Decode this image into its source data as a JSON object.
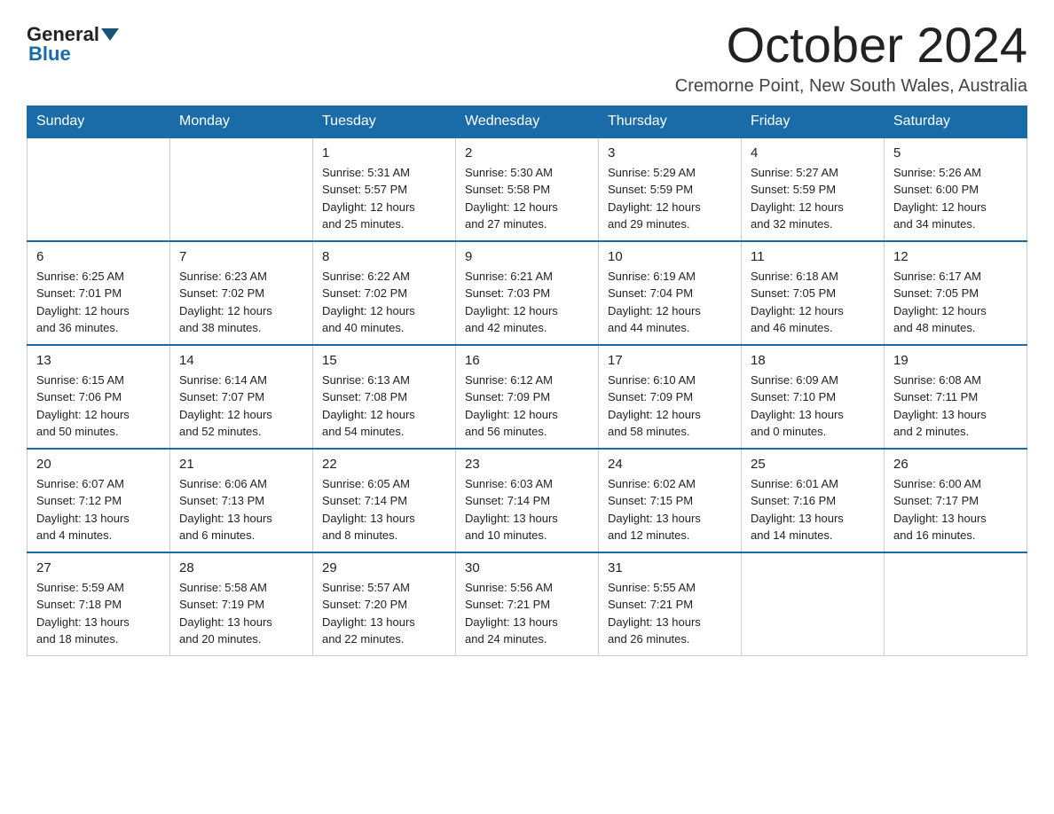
{
  "logo": {
    "general": "General",
    "blue": "Blue"
  },
  "title": "October 2024",
  "location": "Cremorne Point, New South Wales, Australia",
  "days_of_week": [
    "Sunday",
    "Monday",
    "Tuesday",
    "Wednesday",
    "Thursday",
    "Friday",
    "Saturday"
  ],
  "weeks": [
    [
      {
        "day": "",
        "info": ""
      },
      {
        "day": "",
        "info": ""
      },
      {
        "day": "1",
        "info": "Sunrise: 5:31 AM\nSunset: 5:57 PM\nDaylight: 12 hours\nand 25 minutes."
      },
      {
        "day": "2",
        "info": "Sunrise: 5:30 AM\nSunset: 5:58 PM\nDaylight: 12 hours\nand 27 minutes."
      },
      {
        "day": "3",
        "info": "Sunrise: 5:29 AM\nSunset: 5:59 PM\nDaylight: 12 hours\nand 29 minutes."
      },
      {
        "day": "4",
        "info": "Sunrise: 5:27 AM\nSunset: 5:59 PM\nDaylight: 12 hours\nand 32 minutes."
      },
      {
        "day": "5",
        "info": "Sunrise: 5:26 AM\nSunset: 6:00 PM\nDaylight: 12 hours\nand 34 minutes."
      }
    ],
    [
      {
        "day": "6",
        "info": "Sunrise: 6:25 AM\nSunset: 7:01 PM\nDaylight: 12 hours\nand 36 minutes."
      },
      {
        "day": "7",
        "info": "Sunrise: 6:23 AM\nSunset: 7:02 PM\nDaylight: 12 hours\nand 38 minutes."
      },
      {
        "day": "8",
        "info": "Sunrise: 6:22 AM\nSunset: 7:02 PM\nDaylight: 12 hours\nand 40 minutes."
      },
      {
        "day": "9",
        "info": "Sunrise: 6:21 AM\nSunset: 7:03 PM\nDaylight: 12 hours\nand 42 minutes."
      },
      {
        "day": "10",
        "info": "Sunrise: 6:19 AM\nSunset: 7:04 PM\nDaylight: 12 hours\nand 44 minutes."
      },
      {
        "day": "11",
        "info": "Sunrise: 6:18 AM\nSunset: 7:05 PM\nDaylight: 12 hours\nand 46 minutes."
      },
      {
        "day": "12",
        "info": "Sunrise: 6:17 AM\nSunset: 7:05 PM\nDaylight: 12 hours\nand 48 minutes."
      }
    ],
    [
      {
        "day": "13",
        "info": "Sunrise: 6:15 AM\nSunset: 7:06 PM\nDaylight: 12 hours\nand 50 minutes."
      },
      {
        "day": "14",
        "info": "Sunrise: 6:14 AM\nSunset: 7:07 PM\nDaylight: 12 hours\nand 52 minutes."
      },
      {
        "day": "15",
        "info": "Sunrise: 6:13 AM\nSunset: 7:08 PM\nDaylight: 12 hours\nand 54 minutes."
      },
      {
        "day": "16",
        "info": "Sunrise: 6:12 AM\nSunset: 7:09 PM\nDaylight: 12 hours\nand 56 minutes."
      },
      {
        "day": "17",
        "info": "Sunrise: 6:10 AM\nSunset: 7:09 PM\nDaylight: 12 hours\nand 58 minutes."
      },
      {
        "day": "18",
        "info": "Sunrise: 6:09 AM\nSunset: 7:10 PM\nDaylight: 13 hours\nand 0 minutes."
      },
      {
        "day": "19",
        "info": "Sunrise: 6:08 AM\nSunset: 7:11 PM\nDaylight: 13 hours\nand 2 minutes."
      }
    ],
    [
      {
        "day": "20",
        "info": "Sunrise: 6:07 AM\nSunset: 7:12 PM\nDaylight: 13 hours\nand 4 minutes."
      },
      {
        "day": "21",
        "info": "Sunrise: 6:06 AM\nSunset: 7:13 PM\nDaylight: 13 hours\nand 6 minutes."
      },
      {
        "day": "22",
        "info": "Sunrise: 6:05 AM\nSunset: 7:14 PM\nDaylight: 13 hours\nand 8 minutes."
      },
      {
        "day": "23",
        "info": "Sunrise: 6:03 AM\nSunset: 7:14 PM\nDaylight: 13 hours\nand 10 minutes."
      },
      {
        "day": "24",
        "info": "Sunrise: 6:02 AM\nSunset: 7:15 PM\nDaylight: 13 hours\nand 12 minutes."
      },
      {
        "day": "25",
        "info": "Sunrise: 6:01 AM\nSunset: 7:16 PM\nDaylight: 13 hours\nand 14 minutes."
      },
      {
        "day": "26",
        "info": "Sunrise: 6:00 AM\nSunset: 7:17 PM\nDaylight: 13 hours\nand 16 minutes."
      }
    ],
    [
      {
        "day": "27",
        "info": "Sunrise: 5:59 AM\nSunset: 7:18 PM\nDaylight: 13 hours\nand 18 minutes."
      },
      {
        "day": "28",
        "info": "Sunrise: 5:58 AM\nSunset: 7:19 PM\nDaylight: 13 hours\nand 20 minutes."
      },
      {
        "day": "29",
        "info": "Sunrise: 5:57 AM\nSunset: 7:20 PM\nDaylight: 13 hours\nand 22 minutes."
      },
      {
        "day": "30",
        "info": "Sunrise: 5:56 AM\nSunset: 7:21 PM\nDaylight: 13 hours\nand 24 minutes."
      },
      {
        "day": "31",
        "info": "Sunrise: 5:55 AM\nSunset: 7:21 PM\nDaylight: 13 hours\nand 26 minutes."
      },
      {
        "day": "",
        "info": ""
      },
      {
        "day": "",
        "info": ""
      }
    ]
  ]
}
